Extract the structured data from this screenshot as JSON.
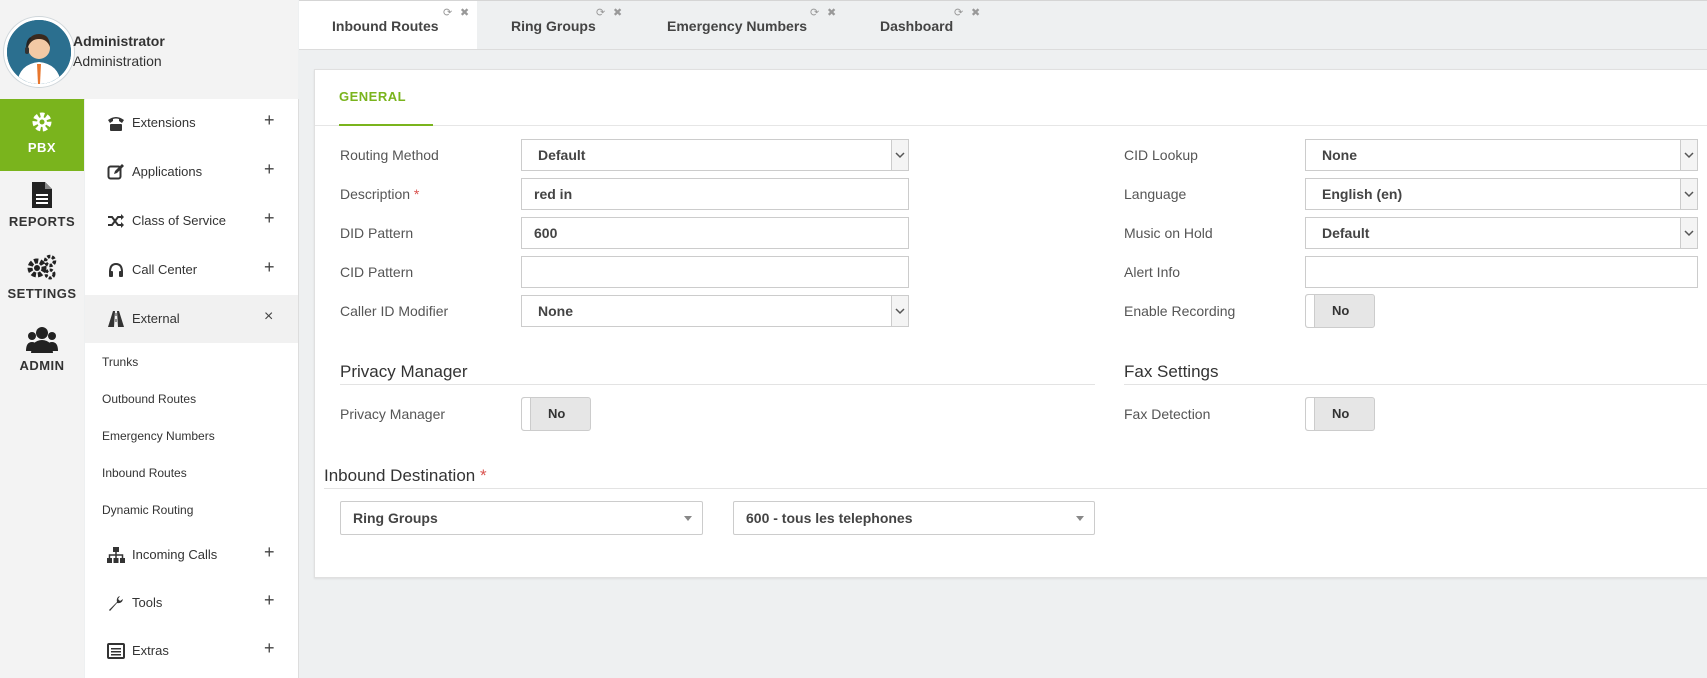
{
  "user": {
    "name": "Administrator",
    "role": "Administration"
  },
  "rail": [
    {
      "label": "PBX",
      "icon": "gear-icon",
      "active": true
    },
    {
      "label": "REPORTS",
      "icon": "document-icon"
    },
    {
      "label": "SETTINGS",
      "icon": "gears-icon"
    },
    {
      "label": "ADMIN",
      "icon": "users-icon"
    }
  ],
  "menu": {
    "items": [
      {
        "label": "Extensions",
        "icon": "phone-icon",
        "toggle": "+"
      },
      {
        "label": "Applications",
        "icon": "edit-icon",
        "toggle": "+"
      },
      {
        "label": "Class of Service",
        "icon": "shuffle-icon",
        "toggle": "+"
      },
      {
        "label": "Call Center",
        "icon": "headset-icon",
        "toggle": "+"
      },
      {
        "label": "External",
        "icon": "road-icon",
        "toggle": "×"
      },
      {
        "label": "Incoming Calls",
        "icon": "sitemap-icon",
        "toggle": "+"
      },
      {
        "label": "Tools",
        "icon": "wrench-icon",
        "toggle": "+"
      },
      {
        "label": "Extras",
        "icon": "list-icon",
        "toggle": "+"
      }
    ],
    "external_sub": [
      "Trunks",
      "Outbound Routes",
      "Emergency Numbers",
      "Inbound Routes",
      "Dynamic Routing"
    ]
  },
  "tabs": [
    "Inbound Routes",
    "Ring Groups",
    "Emergency Numbers",
    "Dashboard"
  ],
  "form": {
    "section_tab": "GENERAL",
    "routing_method": {
      "label": "Routing Method",
      "value": "Default"
    },
    "description": {
      "label": "Description",
      "required": "*",
      "value": "red in"
    },
    "did_pattern": {
      "label": "DID Pattern",
      "value": "600"
    },
    "cid_pattern": {
      "label": "CID Pattern",
      "value": ""
    },
    "caller_id_modifier": {
      "label": "Caller ID Modifier",
      "value": "None"
    },
    "cid_lookup": {
      "label": "CID Lookup",
      "value": "None"
    },
    "language": {
      "label": "Language",
      "value": "English (en)"
    },
    "music_on_hold": {
      "label": "Music on Hold",
      "value": "Default"
    },
    "alert_info": {
      "label": "Alert Info",
      "value": ""
    },
    "enable_recording": {
      "label": "Enable Recording",
      "value": "No"
    },
    "privacy_section": "Privacy Manager",
    "privacy_manager": {
      "label": "Privacy Manager",
      "value": "No"
    },
    "fax_section": "Fax Settings",
    "fax_detection": {
      "label": "Fax Detection",
      "value": "No"
    },
    "inbound_destination": {
      "label": "Inbound Destination",
      "required": "*",
      "type": "Ring Groups",
      "target": "600 - tous les telephones"
    }
  },
  "colors": {
    "accent": "#7ab41d",
    "required": "#d9534f"
  }
}
